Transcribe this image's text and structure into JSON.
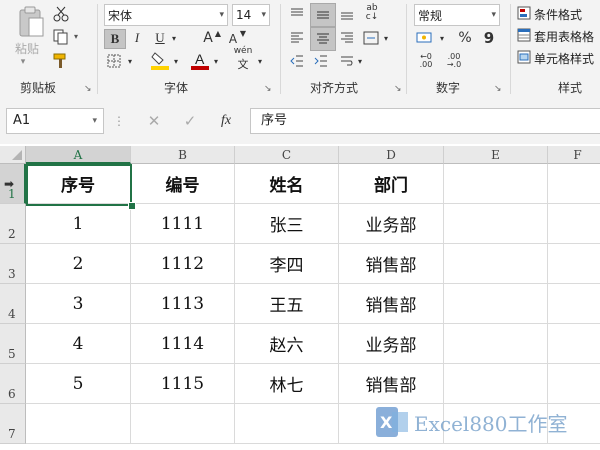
{
  "ribbon": {
    "clipboard": {
      "paste_label": "粘贴",
      "group_label": "剪贴板"
    },
    "font": {
      "font_name": "宋体",
      "font_size": "14",
      "bold": "B",
      "italic": "I",
      "underline": "U",
      "grow": "A",
      "shrink": "A",
      "phonetic": "wén",
      "group_label": "字体"
    },
    "alignment": {
      "group_label": "对齐方式",
      "wrap_icon": "ab"
    },
    "number": {
      "format": "常规",
      "percent": "%",
      "comma": "9",
      "group_label": "数字"
    },
    "styles": {
      "conditional": "条件格式",
      "table": "套用表格格",
      "cell": "单元格样式",
      "group_label": "样式"
    }
  },
  "formula_bar": {
    "name_box": "A1",
    "fx": "fx",
    "content": "序号"
  },
  "columns": [
    "A",
    "B",
    "C",
    "D",
    "E",
    "F"
  ],
  "rows": [
    "1",
    "2",
    "3",
    "4",
    "5",
    "6",
    "7"
  ],
  "table": {
    "headers": [
      "序号",
      "编号",
      "姓名",
      "部门"
    ],
    "data": [
      [
        "1",
        "1111",
        "张三",
        "业务部"
      ],
      [
        "2",
        "1112",
        "李四",
        "销售部"
      ],
      [
        "3",
        "1113",
        "王五",
        "销售部"
      ],
      [
        "4",
        "1114",
        "赵六",
        "业务部"
      ],
      [
        "5",
        "1115",
        "林七",
        "销售部"
      ]
    ]
  },
  "watermark": {
    "text": "Excel880工作室"
  },
  "colors": {
    "accent": "#217346",
    "font_color": "#c00000",
    "fill_color": "#ffd200"
  }
}
